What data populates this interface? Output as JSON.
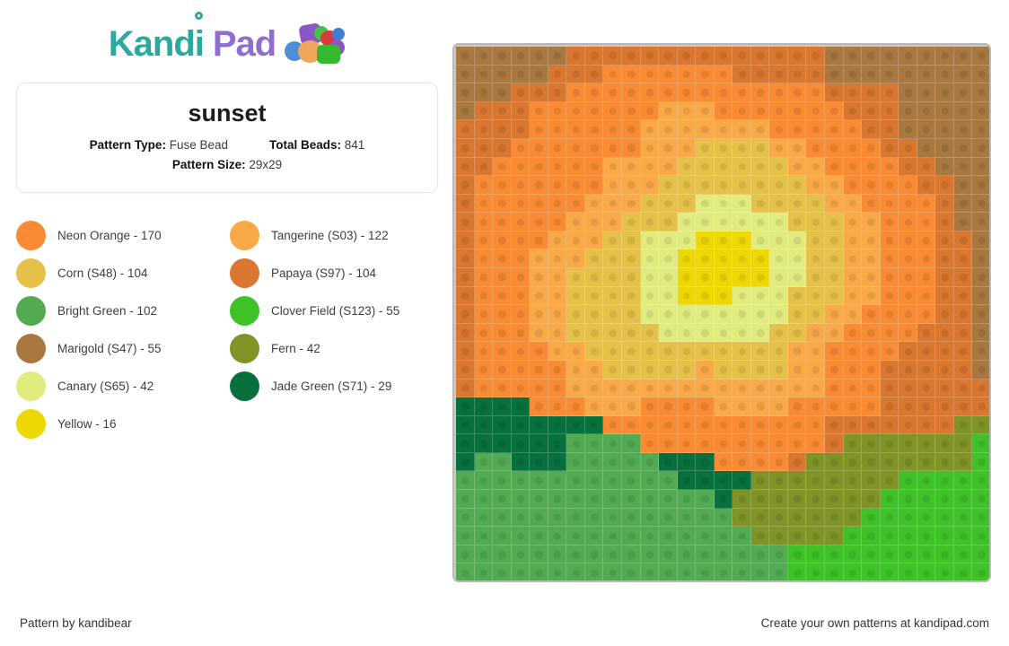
{
  "brand": {
    "name_part1": "Kandi",
    "name_part2": "Pad",
    "accent_teal": "#2aa9a0",
    "accent_purple": "#8f6ed0"
  },
  "pattern": {
    "title": "sunset",
    "type_label": "Pattern Type:",
    "type_value": "Fuse Bead",
    "total_label": "Total Beads:",
    "total_value": "841",
    "size_label": "Pattern Size:",
    "size_value": "29x29"
  },
  "legend": [
    {
      "name": "Neon Orange - 170",
      "color": "#f88b33"
    },
    {
      "name": "Tangerine (S03) - 122",
      "color": "#f9a948"
    },
    {
      "name": "Corn (S48) - 104",
      "color": "#e6c149"
    },
    {
      "name": "Papaya (S97) - 104",
      "color": "#d9762f"
    },
    {
      "name": "Bright Green - 102",
      "color": "#52ab52"
    },
    {
      "name": "Clover Field (S123) - 55",
      "color": "#3ec228"
    },
    {
      "name": "Marigold (S47) - 55",
      "color": "#a87840"
    },
    {
      "name": "Fern - 42",
      "color": "#7f9327"
    },
    {
      "name": "Canary (S65) - 42",
      "color": "#e2ec7e"
    },
    {
      "name": "Jade Green (S71) - 29",
      "color": "#08703c"
    },
    {
      "name": "Yellow - 16",
      "color": "#eed803"
    }
  ],
  "footer": {
    "left": "Pattern by kandibear",
    "right": "Create your own patterns at kandipad.com"
  },
  "chart_data": {
    "type": "heatmap",
    "title": "sunset",
    "rows": 29,
    "cols": 29,
    "palette": {
      "O": "#f88b33",
      "T": "#f9a948",
      "C": "#e6c149",
      "P": "#d9762f",
      "B": "#52ab52",
      "L": "#3ec228",
      "M": "#a87840",
      "F": "#7f9327",
      "N": "#e2ec7e",
      "J": "#08703c",
      "Y": "#eed803"
    },
    "palette_names": {
      "O": "Neon Orange",
      "T": "Tangerine (S03)",
      "C": "Corn (S48)",
      "P": "Papaya (S97)",
      "B": "Bright Green",
      "L": "Clover Field (S123)",
      "M": "Marigold (S47)",
      "F": "Fern",
      "N": "Canary (S65)",
      "J": "Jade Green (S71)",
      "Y": "Yellow"
    },
    "grid": [
      "MMMMMMPPPPPPPPPPPPPPMMMMMMMMM",
      "MMMMMPPPOOOOOOOPPPPPMMMMMMMMM",
      "MMMPPPOOOOOOOOOOOOOOPPPPMMMMM",
      "MPPPOOOOOOOTTTOOOOOOOPPPMMMMM",
      "PPPPOOOOOOTTTTTTTOOOOOPPMMMMM",
      "PPPOOOOOOOTTTCCCCTTOOOOPPMMMM",
      "PPOOOOOOTTTTCCCCCCTTOOOOPPMMM",
      "POOOOOOOTTTCCCCCCCCTTOOOOPPMM",
      "POOOOOOTTTCCCNNNCCCCTTOOOOPMM",
      "POOOOOTTTCCCNNNNNNCCCTTOOOPMM",
      "POOOOTTTCCNNNYYYNNNCCTTOOOPPM",
      "POOOTTTCCCNNYYYYYNNCCTTOOOPPM",
      "POOOTTCCCCNNYYYYYNNCCTTOOOPPM",
      "POOOTTCCCCNNYYYNNNCCCTTOOOPPM",
      "POOOTTCCCCNNNNNNNNCCTTOOOOPPM",
      "POOOTTCCCCCNNNNNNCCTTOOOOPPPM",
      "POOOOTTCCCCCCCCCCCTTOOOOPPPPM",
      "POOOOOTTCCCCCTCCCCTTOOOPPPPPM",
      "POOOOOTTTTTTTTTTTTTTOOOPPPPPP",
      "JJJJOOOTTTOOOOTTTTOOOOOPPPPPP",
      "JJJJJJJJOOOOOOOOOOOOPPPPPPPFF",
      "JJJJJJBBBBOOOOOOOOOOPFFFFFFFL",
      "JBBJJJBBBBBJJJOOOOPFFFFFFFFFL",
      "BBBBBBBBBBBBJJJJFFFFFFFFLLLLL",
      "BBBBBBBBBBBBBBJFFFFFFFFLLLLLL",
      "BBBBBBBBBBBBBBBFFFFFFFLLLLLLL",
      "BBBBBBBBBBBBBBBBFFFFFLLLLLLLL",
      "BBBBBBBBBBBBBBBBBBLLLLLLLLLLL",
      "BBBBBBBBBBBBBBBBBBLLLLLLLLLLL"
    ]
  }
}
